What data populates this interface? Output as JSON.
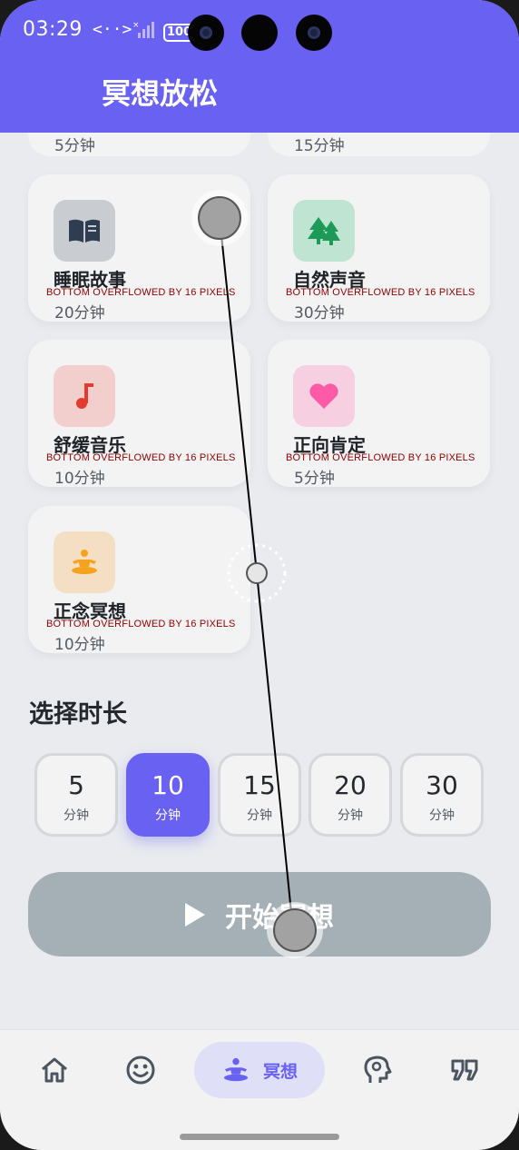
{
  "status_bar": {
    "time": "03:29",
    "code_icon": "<··>",
    "battery_text": "100"
  },
  "app_bar": {
    "title": "冥想放松"
  },
  "partial_row": [
    {
      "duration": "5分钟"
    },
    {
      "duration": "15分钟"
    }
  ],
  "cards": [
    {
      "title": "睡眠故事",
      "duration": "20分钟",
      "icon": "book-open-icon",
      "icon_bg": "#c9ccd1",
      "icon_color": "#2e3e50",
      "overflow_msg": "BOTTOM OVERFLOWED BY 16 PIXELS"
    },
    {
      "title": "自然声音",
      "duration": "30分钟",
      "icon": "trees-icon",
      "icon_bg": "#bfe5d2",
      "icon_color": "#1e9a58",
      "overflow_msg": "BOTTOM OVERFLOWED BY 16 PIXELS"
    },
    {
      "title": "舒缓音乐",
      "duration": "10分钟",
      "icon": "music-note-icon",
      "icon_bg": "#f2cfcd",
      "icon_color": "#e23b30",
      "overflow_msg": "BOTTOM OVERFLOWED BY 16 PIXELS"
    },
    {
      "title": "正向肯定",
      "duration": "5分钟",
      "icon": "heart-icon",
      "icon_bg": "#f6d0e1",
      "icon_color": "#ff5aa8",
      "overflow_msg": "BOTTOM OVERFLOWED BY 16 PIXELS"
    },
    {
      "title": "正念冥想",
      "duration": "10分钟",
      "icon": "meditation-icon",
      "icon_bg": "#f5dfc4",
      "icon_color": "#f5a21e",
      "overflow_msg": "BOTTOM OVERFLOWED BY 16 PIXELS"
    }
  ],
  "duration_section": {
    "title": "选择时长",
    "options": [
      {
        "value": "5",
        "unit": "分钟",
        "selected": false
      },
      {
        "value": "10",
        "unit": "分钟",
        "selected": true
      },
      {
        "value": "15",
        "unit": "分钟",
        "selected": false
      },
      {
        "value": "20",
        "unit": "分钟",
        "selected": false
      },
      {
        "value": "30",
        "unit": "分钟",
        "selected": false
      }
    ]
  },
  "start_button": {
    "label": "开始冥想",
    "icon": "play-icon"
  },
  "bottom_nav": {
    "items": [
      {
        "icon": "home-icon",
        "label": ""
      },
      {
        "icon": "smiley-icon",
        "label": ""
      },
      {
        "icon": "meditation-icon",
        "label": "冥想",
        "active": true
      },
      {
        "icon": "brain-head-icon",
        "label": ""
      },
      {
        "icon": "quote-icon",
        "label": ""
      }
    ]
  },
  "colors": {
    "primary": "#6861f2",
    "background": "#e9ebef",
    "card": "#f3f3f3",
    "disabled_button": "#a5b0b6",
    "overflow_text": "#8b0000"
  }
}
